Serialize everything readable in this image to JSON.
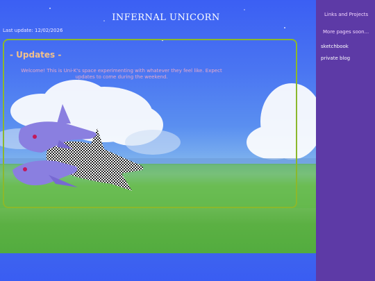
{
  "header": {
    "title": "INFERNAL UNICORN",
    "last_update": "Last update: 12/02/2026"
  },
  "updates": {
    "heading": "- Updates -",
    "body": "Welcome! This is Uni-K's space experimenting with whatever they feel like. Expect updates to come during the weekend."
  },
  "sidebar": {
    "links_projects": "Links and Projects",
    "more_pages": "More pages soon...",
    "items": [
      {
        "label": "sketchbook"
      },
      {
        "label": "private blog"
      }
    ]
  },
  "colors": {
    "sidebar_bg": "#5d3aa6",
    "panel_border": "#8bb82c",
    "heading": "#f2c08a",
    "body_text": "#e9a9c9"
  }
}
